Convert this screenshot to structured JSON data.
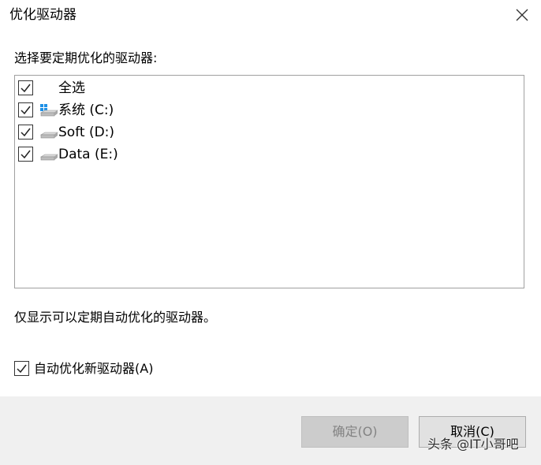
{
  "dialog": {
    "title": "优化驱动器",
    "close_icon": "close-icon"
  },
  "prompt": "选择要定期优化的驱动器:",
  "drives": [
    {
      "label": "全选",
      "checked": true,
      "icon": "none"
    },
    {
      "label": "系统 (C:)",
      "checked": true,
      "icon": "windows-drive-icon"
    },
    {
      "label": "Soft (D:)",
      "checked": true,
      "icon": "drive-icon"
    },
    {
      "label": "Data (E:)",
      "checked": true,
      "icon": "drive-icon"
    }
  ],
  "info_text": "仅显示可以定期自动优化的驱动器。",
  "auto_optimize": {
    "label": "自动优化新驱动器(A)",
    "checked": true
  },
  "buttons": {
    "ok_label": "确定(O)",
    "ok_enabled": false,
    "cancel_label": "取消(C)"
  },
  "watermark": "头条 @IT小哥吧",
  "colors": {
    "footer_bg": "#f0f0f0",
    "disabled_button_bg": "#cccccc",
    "windows_blue": "#1e90e6"
  }
}
